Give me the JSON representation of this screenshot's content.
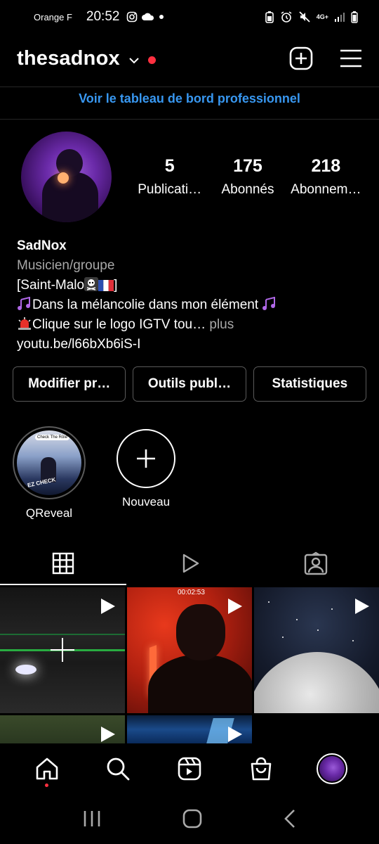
{
  "status_bar": {
    "carrier": "Orange F",
    "time": "20:52",
    "network": "4G+"
  },
  "header": {
    "username": "thesadnox"
  },
  "dashboard_link": "Voir le tableau de bord professionnel",
  "stats": [
    {
      "value": "5",
      "label": "Publicati…"
    },
    {
      "value": "175",
      "label": "Abonnés"
    },
    {
      "value": "218",
      "label": "Abonnem…"
    }
  ],
  "bio": {
    "name": "SadNox",
    "category": "Musicien/groupe",
    "line1_text": "[Saint-Malo",
    "line1_end": "]",
    "line2": "Dans la mélancolie dans mon élément ",
    "line3": "Clique sur le logo IGTV tou… ",
    "more": "plus",
    "link": "youtu.be/l66bXb6iS-I"
  },
  "buttons": {
    "edit": "Modifier pr…",
    "tools": "Outils publ…",
    "insights": "Statistiques"
  },
  "highlights": [
    {
      "label": "QReveal",
      "thumb_text": "LEZ CHECK",
      "thumb_tag": "Check The Rôle"
    },
    {
      "label": "Nouveau"
    }
  ],
  "grid": {
    "first_thumb_timer": "00:02:53"
  },
  "colors": {
    "accent_link": "#3897f0",
    "notification": "#ff3040",
    "secondary_text": "#a8a8a8"
  }
}
